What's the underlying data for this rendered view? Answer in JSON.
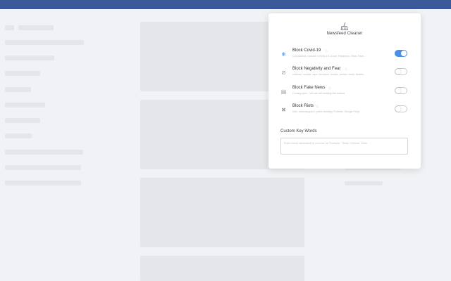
{
  "theme": {
    "topbar": "#3b5998",
    "toggle_on": "#4a90e2",
    "placeholder": "#e4e6ea"
  },
  "popup": {
    "title": "Newsfeed Cleaner",
    "logo_icon": "broom-icon",
    "filters": [
      {
        "id": "covid",
        "icon": "snowflake-virus-icon",
        "label": "Block Covid-19",
        "info_icon": "info-icon",
        "description": "Coronavirus, Corona, COVID-19, Covid, Pandemic, Virus, Face...",
        "enabled": true
      },
      {
        "id": "negativity",
        "icon": "no-sign-icon",
        "label": "Block Negativity and Fear",
        "info_icon": "info-icon",
        "description": "violence, suicide, rape, terrorism, murder, torture, racist, deaths...",
        "enabled": false
      },
      {
        "id": "fake-news",
        "icon": "newspaper-icon",
        "label": "Block Fake News",
        "info_icon": "info-icon",
        "description": "Coming soon - We are still building this feature",
        "enabled": false
      },
      {
        "id": "riots",
        "icon": "crossed-tools-icon",
        "label": "Block Riots",
        "info_icon": "info-icon",
        "description": "riots, national guard, police brutality, Protests, George Floyd",
        "enabled": false
      }
    ],
    "custom_keywords": {
      "label": "Custom Key Words",
      "placeholder": "Enter words separated by comma, for Example : Tesla, Chinese, Birds"
    }
  }
}
